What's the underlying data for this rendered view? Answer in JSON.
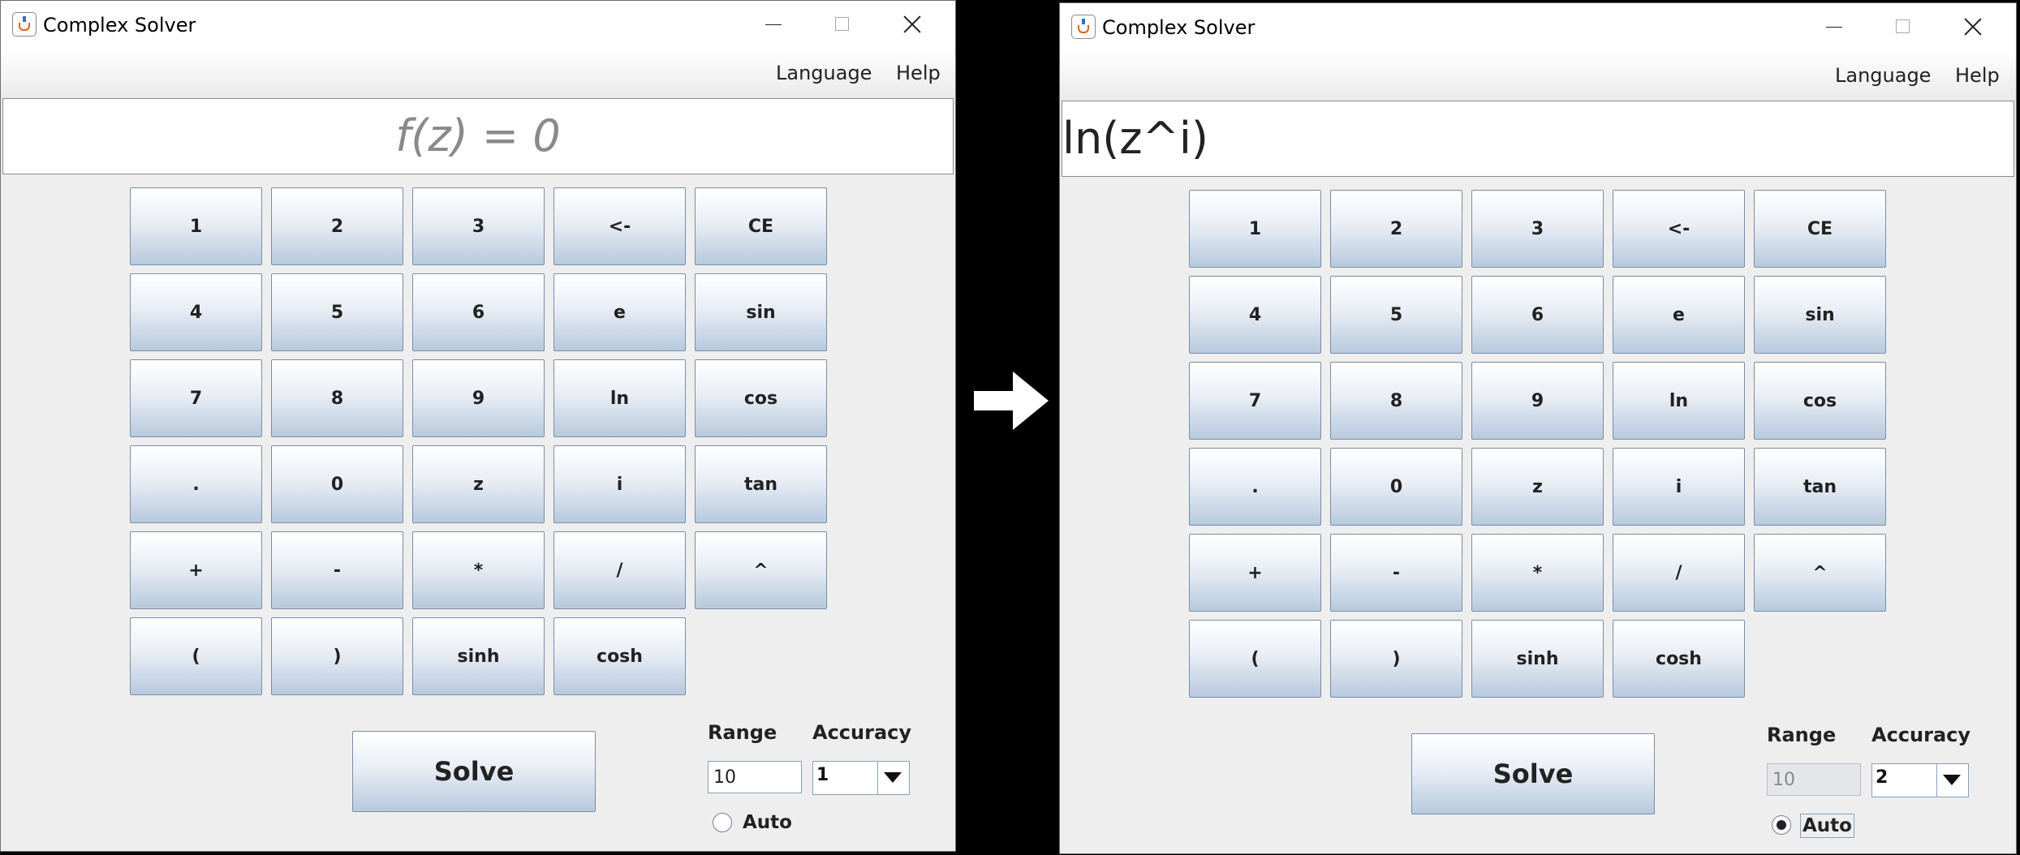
{
  "window_title": "Complex Solver",
  "menu": {
    "language": "Language",
    "help": "Help"
  },
  "keys": [
    "1",
    "2",
    "3",
    "<-",
    "CE",
    "4",
    "5",
    "6",
    "e",
    "sin",
    "7",
    "8",
    "9",
    "ln",
    "cos",
    ".",
    "0",
    "z",
    "i",
    "tan",
    "+",
    "-",
    "*",
    "/",
    "^",
    "(",
    ")",
    "sinh",
    "cosh"
  ],
  "solve_label": "Solve",
  "range_label": "Range",
  "accuracy_label": "Accuracy",
  "auto_label": "Auto",
  "left": {
    "placeholder": "f(z) = 0",
    "range_value": "10",
    "accuracy_value": "1",
    "auto_checked": false
  },
  "right": {
    "expression": "ln(z^i)",
    "range_value": "10",
    "accuracy_value": "2",
    "auto_checked": true
  },
  "icons": {
    "transition": "right-arrow-icon",
    "app": "java-cup-icon"
  }
}
